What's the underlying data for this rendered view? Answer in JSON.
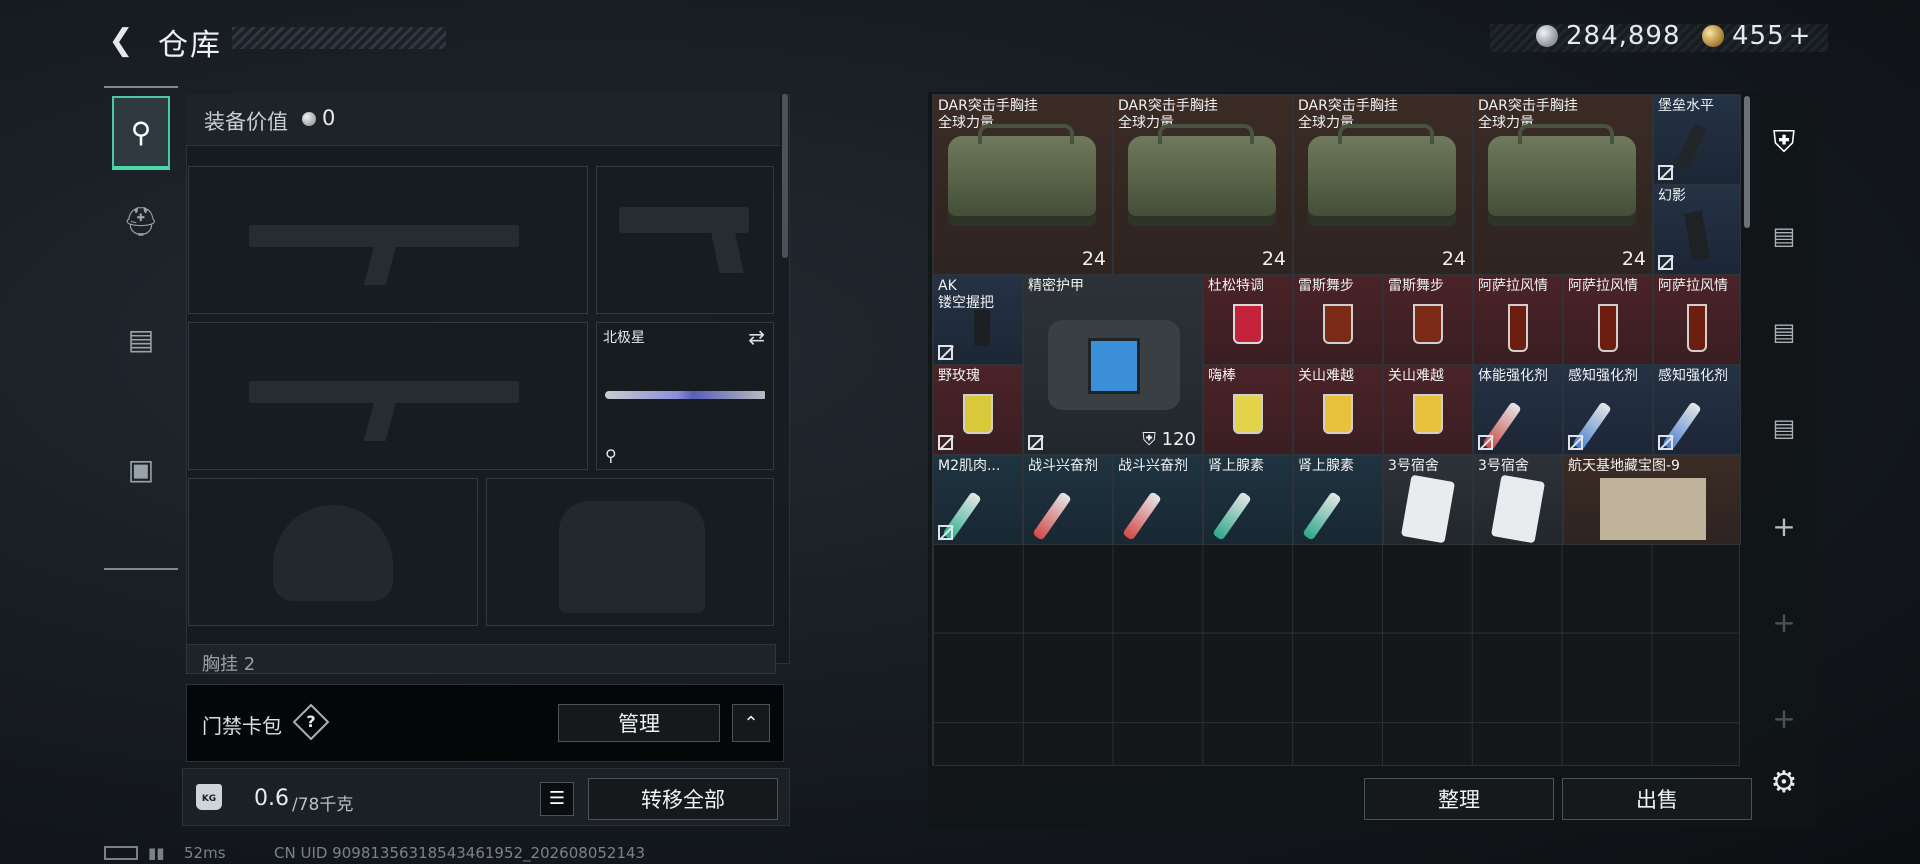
{
  "header": {
    "title": "仓库",
    "silver_amount": "284,898",
    "gold_amount": "455",
    "gold_plus": "+"
  },
  "left": {
    "equip_label": "装备价值",
    "equip_value": "0",
    "knife_label": "北极星",
    "chest_label": "胸挂",
    "chest_count": "2",
    "keycard_label": "门禁卡包",
    "keycard_help": "?",
    "manage_label": "管理",
    "weight_value": "0.6",
    "weight_capacity": "/78千克",
    "transfer_all_label": "转移全部"
  },
  "status": {
    "latency": "52ms",
    "uid": "CN UID 9098135631854346195​2_202608052143"
  },
  "grid": {
    "items": [
      {
        "name": "DAR突击手胸挂\n全球力量",
        "count": "24"
      },
      {
        "name": "DAR突击手胸挂\n全球力量",
        "count": "24"
      },
      {
        "name": "DAR突击手胸挂\n全球力量",
        "count": "24"
      },
      {
        "name": "DAR突击手胸挂\n全球力量",
        "count": "24"
      },
      {
        "name": "堡垒水平"
      },
      {
        "name": "幻影"
      },
      {
        "name": "AK\n镂空握把"
      },
      {
        "name": "精密护甲",
        "count": "120"
      },
      {
        "name": "杜松特调"
      },
      {
        "name": "雷斯舞步"
      },
      {
        "name": "雷斯舞步"
      },
      {
        "name": "阿萨拉风情"
      },
      {
        "name": "阿萨拉风情"
      },
      {
        "name": "阿萨拉风情"
      },
      {
        "name": "野玫瑰"
      },
      {
        "name": "嗨棒"
      },
      {
        "name": "关山难越"
      },
      {
        "name": "关山难越"
      },
      {
        "name": "体能强化剂"
      },
      {
        "name": "感知强化剂"
      },
      {
        "name": "感知强化剂"
      },
      {
        "name": "M2肌肉..."
      },
      {
        "name": "战斗兴奋剂"
      },
      {
        "name": "战斗兴奋剂"
      },
      {
        "name": "肾上腺素"
      },
      {
        "name": "肾上腺素"
      },
      {
        "name": "3号宿舍"
      },
      {
        "name": "3号宿舍"
      },
      {
        "name": "航天基地藏宝图-9"
      }
    ]
  },
  "actions": {
    "sort_label": "整理",
    "sell_label": "出售"
  },
  "colors": {
    "accent": "#4cd9a8",
    "bg": "#161b20",
    "cell_brown": "#3b2b25",
    "cell_red": "#4a2327",
    "cell_blue": "#253245"
  }
}
